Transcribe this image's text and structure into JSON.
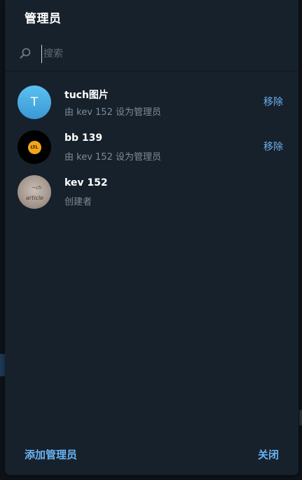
{
  "dialog": {
    "title": "管理员",
    "search_placeholder": "搜索"
  },
  "admins": [
    {
      "name": "tuch图片",
      "subtitle": "由 kev 152 设为管理员",
      "avatar_letter": "T",
      "action": "移除"
    },
    {
      "name": "bb 139",
      "subtitle": "由 kev 152 设为管理员",
      "avatar_badge": "LTL",
      "action": "移除"
    },
    {
      "name": "kev 152",
      "subtitle": "创建者"
    }
  ],
  "footer": {
    "add_label": "添加管理员",
    "close_label": "关闭"
  },
  "colors": {
    "accent": "#6ab2f2",
    "panel": "#17212b",
    "secondary_text": "#7c8b99"
  }
}
